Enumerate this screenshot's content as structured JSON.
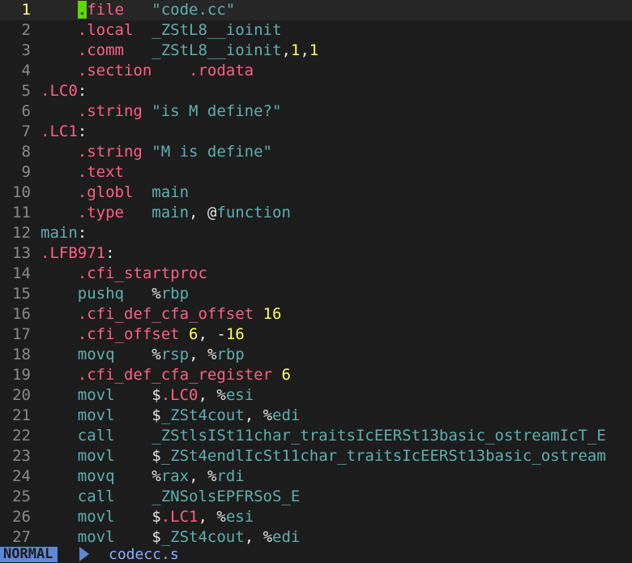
{
  "editor": {
    "lines": [
      {
        "n": "1",
        "current": true,
        "tokens": [
          {
            "t": "    ",
            "c": "p"
          },
          {
            "t": ".",
            "c": "d",
            "cursor": true
          },
          {
            "t": "file   ",
            "c": "d"
          },
          {
            "t": "\"code.cc\"",
            "c": "i"
          }
        ]
      },
      {
        "n": "2",
        "tokens": [
          {
            "t": "    ",
            "c": "p"
          },
          {
            "t": ".local  ",
            "c": "d"
          },
          {
            "t": "_ZStL8__ioinit",
            "c": "i"
          }
        ]
      },
      {
        "n": "3",
        "tokens": [
          {
            "t": "    ",
            "c": "p"
          },
          {
            "t": ".comm   ",
            "c": "d"
          },
          {
            "t": "_ZStL8__ioinit",
            "c": "i"
          },
          {
            "t": ",",
            "c": "p"
          },
          {
            "t": "1",
            "c": "n"
          },
          {
            "t": ",",
            "c": "p"
          },
          {
            "t": "1",
            "c": "n"
          }
        ]
      },
      {
        "n": "4",
        "tokens": [
          {
            "t": "    ",
            "c": "p"
          },
          {
            "t": ".section    .rodata",
            "c": "d"
          }
        ]
      },
      {
        "n": "5",
        "tokens": [
          {
            "t": ".LC0",
            "c": "d"
          },
          {
            "t": ":",
            "c": "p"
          }
        ]
      },
      {
        "n": "6",
        "tokens": [
          {
            "t": "    ",
            "c": "p"
          },
          {
            "t": ".string ",
            "c": "d"
          },
          {
            "t": "\"is M define?\"",
            "c": "i"
          }
        ]
      },
      {
        "n": "7",
        "tokens": [
          {
            "t": ".LC1",
            "c": "d"
          },
          {
            "t": ":",
            "c": "p"
          }
        ]
      },
      {
        "n": "8",
        "tokens": [
          {
            "t": "    ",
            "c": "p"
          },
          {
            "t": ".string ",
            "c": "d"
          },
          {
            "t": "\"M is define\"",
            "c": "i"
          }
        ]
      },
      {
        "n": "9",
        "tokens": [
          {
            "t": "    ",
            "c": "p"
          },
          {
            "t": ".text",
            "c": "d"
          }
        ]
      },
      {
        "n": "10",
        "tokens": [
          {
            "t": "    ",
            "c": "p"
          },
          {
            "t": ".globl  ",
            "c": "d"
          },
          {
            "t": "main",
            "c": "i"
          }
        ]
      },
      {
        "n": "11",
        "tokens": [
          {
            "t": "    ",
            "c": "p"
          },
          {
            "t": ".type   ",
            "c": "d"
          },
          {
            "t": "main",
            "c": "i"
          },
          {
            "t": ", @",
            "c": "p"
          },
          {
            "t": "function",
            "c": "i"
          }
        ]
      },
      {
        "n": "12",
        "tokens": [
          {
            "t": "main",
            "c": "i"
          },
          {
            "t": ":",
            "c": "p"
          }
        ]
      },
      {
        "n": "13",
        "tokens": [
          {
            "t": ".LFB971",
            "c": "d"
          },
          {
            "t": ":",
            "c": "p"
          }
        ]
      },
      {
        "n": "14",
        "tokens": [
          {
            "t": "    ",
            "c": "p"
          },
          {
            "t": ".cfi_startproc",
            "c": "d"
          }
        ]
      },
      {
        "n": "15",
        "tokens": [
          {
            "t": "    ",
            "c": "p"
          },
          {
            "t": "pushq   ",
            "c": "i"
          },
          {
            "t": "%",
            "c": "p"
          },
          {
            "t": "rbp",
            "c": "i"
          }
        ]
      },
      {
        "n": "16",
        "tokens": [
          {
            "t": "    ",
            "c": "p"
          },
          {
            "t": ".cfi_def_cfa_offset ",
            "c": "d"
          },
          {
            "t": "16",
            "c": "n"
          }
        ]
      },
      {
        "n": "17",
        "tokens": [
          {
            "t": "    ",
            "c": "p"
          },
          {
            "t": ".cfi_offset ",
            "c": "d"
          },
          {
            "t": "6",
            "c": "n"
          },
          {
            "t": ", -",
            "c": "p"
          },
          {
            "t": "16",
            "c": "n"
          }
        ]
      },
      {
        "n": "18",
        "tokens": [
          {
            "t": "    ",
            "c": "p"
          },
          {
            "t": "movq    ",
            "c": "i"
          },
          {
            "t": "%",
            "c": "p"
          },
          {
            "t": "rsp",
            "c": "i"
          },
          {
            "t": ", %",
            "c": "p"
          },
          {
            "t": "rbp",
            "c": "i"
          }
        ]
      },
      {
        "n": "19",
        "tokens": [
          {
            "t": "    ",
            "c": "p"
          },
          {
            "t": ".cfi_def_cfa_register ",
            "c": "d"
          },
          {
            "t": "6",
            "c": "n"
          }
        ]
      },
      {
        "n": "20",
        "tokens": [
          {
            "t": "    ",
            "c": "p"
          },
          {
            "t": "movl    ",
            "c": "i"
          },
          {
            "t": "$",
            "c": "p"
          },
          {
            "t": ".LC0",
            "c": "d"
          },
          {
            "t": ", %",
            "c": "p"
          },
          {
            "t": "esi",
            "c": "i"
          }
        ]
      },
      {
        "n": "21",
        "tokens": [
          {
            "t": "    ",
            "c": "p"
          },
          {
            "t": "movl    ",
            "c": "i"
          },
          {
            "t": "$",
            "c": "p"
          },
          {
            "t": "_ZSt4cout",
            "c": "i"
          },
          {
            "t": ", %",
            "c": "p"
          },
          {
            "t": "edi",
            "c": "i"
          }
        ]
      },
      {
        "n": "22",
        "tokens": [
          {
            "t": "    ",
            "c": "p"
          },
          {
            "t": "call    ",
            "c": "i"
          },
          {
            "t": "_ZStlsISt11char_traitsIcEERSt13basic_ostreamIcT_E",
            "c": "i"
          }
        ]
      },
      {
        "n": "23",
        "tokens": [
          {
            "t": "    ",
            "c": "p"
          },
          {
            "t": "movl    ",
            "c": "i"
          },
          {
            "t": "$",
            "c": "p"
          },
          {
            "t": "_ZSt4endlIcSt11char_traitsIcEERSt13basic_ostream",
            "c": "i"
          }
        ]
      },
      {
        "n": "24",
        "tokens": [
          {
            "t": "    ",
            "c": "p"
          },
          {
            "t": "movq    ",
            "c": "i"
          },
          {
            "t": "%",
            "c": "p"
          },
          {
            "t": "rax",
            "c": "i"
          },
          {
            "t": ", %",
            "c": "p"
          },
          {
            "t": "rdi",
            "c": "i"
          }
        ]
      },
      {
        "n": "25",
        "tokens": [
          {
            "t": "    ",
            "c": "p"
          },
          {
            "t": "call    ",
            "c": "i"
          },
          {
            "t": "_ZNSolsEPFRSoS_E",
            "c": "i"
          }
        ]
      },
      {
        "n": "26",
        "tokens": [
          {
            "t": "    ",
            "c": "p"
          },
          {
            "t": "movl    ",
            "c": "i"
          },
          {
            "t": "$",
            "c": "p"
          },
          {
            "t": ".LC1",
            "c": "d"
          },
          {
            "t": ", %",
            "c": "p"
          },
          {
            "t": "esi",
            "c": "i"
          }
        ]
      },
      {
        "n": "27",
        "tokens": [
          {
            "t": "    ",
            "c": "p"
          },
          {
            "t": "movl    ",
            "c": "i"
          },
          {
            "t": "$",
            "c": "p"
          },
          {
            "t": "_ZSt4cout",
            "c": "i"
          },
          {
            "t": ", %",
            "c": "p"
          },
          {
            "t": "edi",
            "c": "i"
          }
        ]
      }
    ]
  },
  "statusline": {
    "mode": "NORMAL",
    "filename": "codecc.s"
  },
  "colors": {
    "background": "#1c1c1c",
    "directive": "#ff5f87",
    "identifier": "#5fafaf",
    "number": "#ffff5f",
    "cursor": "#5fd700",
    "mode_bg": "#5f87d7"
  }
}
